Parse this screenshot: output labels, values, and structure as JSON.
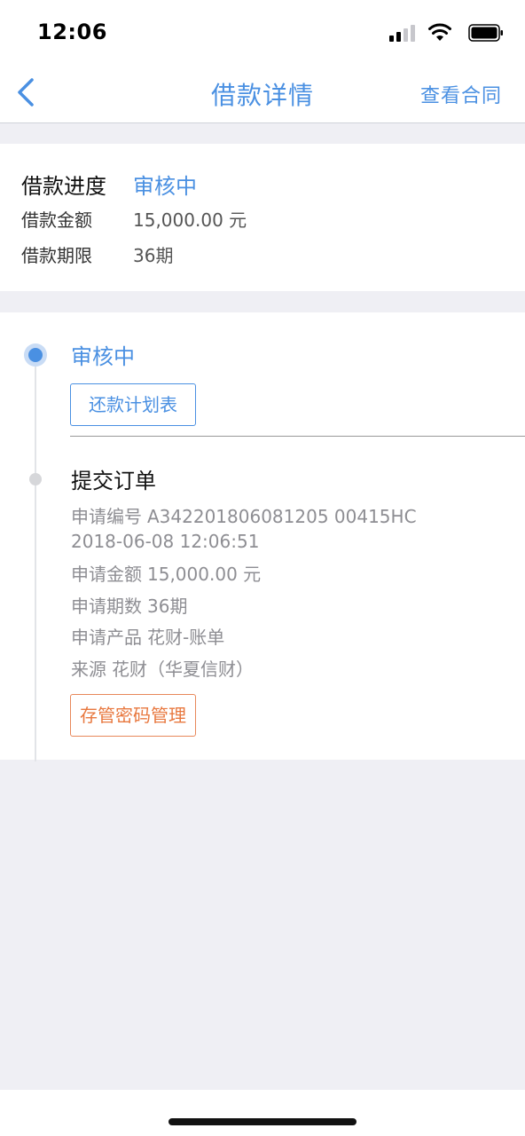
{
  "status_bar": {
    "time": "12:06",
    "icons": [
      "cellular-signal-icon",
      "wifi-icon",
      "battery-icon"
    ]
  },
  "nav": {
    "back_icon": "chevron-left-icon",
    "title": "借款详情",
    "action_label": "查看合同"
  },
  "summary": {
    "progress_label": "借款进度",
    "progress_value": "审核中",
    "amount_label": "借款金额",
    "amount_value": "15,000.00 元",
    "term_label": "借款期限",
    "term_value": "36期"
  },
  "timeline": {
    "steps": [
      {
        "title": "审核中",
        "status": "active",
        "button_label": "还款计划表"
      },
      {
        "title": "提交订单",
        "status": "done",
        "details": [
          {
            "key": "申请编号",
            "value": "A342201806081205 00415HC"
          },
          {
            "key": "",
            "value": "2018-06-08 12:06:51"
          },
          {
            "key": "申请金额",
            "value": "15,000.00 元"
          },
          {
            "key": "申请期数",
            "value": "36期"
          },
          {
            "key": "申请产品",
            "value": "花财-账单"
          },
          {
            "key": "来源",
            "value": "花财（华夏信财）"
          }
        ],
        "button_label": "存管密码管理"
      }
    ]
  },
  "colors": {
    "accent": "#4a90e2",
    "warning": "#e8783f",
    "background": "#efeff4"
  }
}
